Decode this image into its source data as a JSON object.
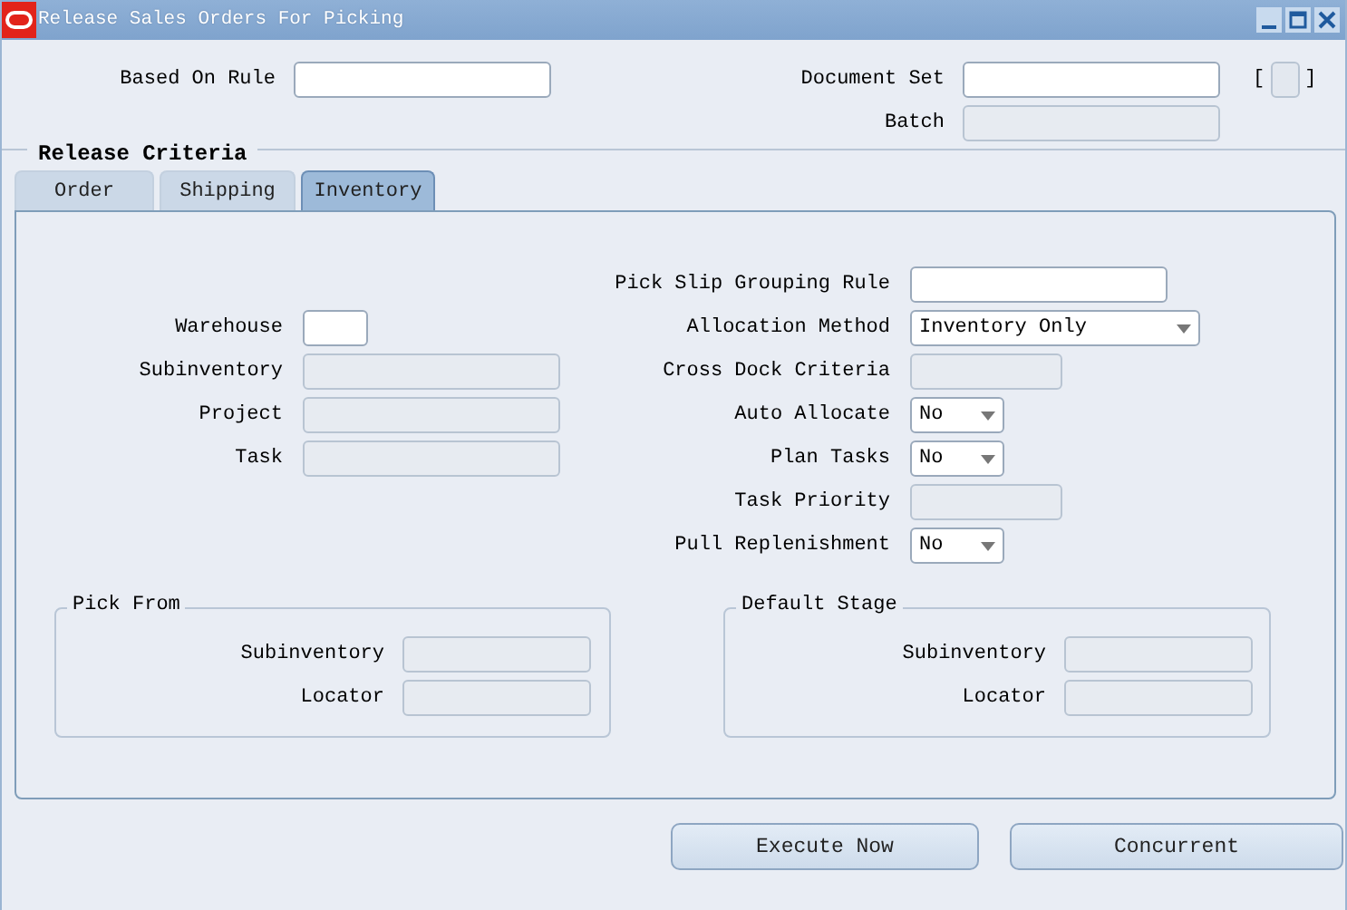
{
  "window": {
    "title": "Release Sales Orders For Picking"
  },
  "header_fields": [
    {
      "label": "Based On Rule",
      "kind": "text"
    },
    {
      "label": "Document Set",
      "kind": "text"
    },
    {
      "label": "Batch",
      "kind": "disabled"
    }
  ],
  "flex_field": {
    "open": "[",
    "close": "]"
  },
  "section_title": "Release Criteria",
  "tabs": [
    {
      "label": "Order",
      "selected": false
    },
    {
      "label": "Shipping",
      "selected": false
    },
    {
      "label": "Inventory",
      "selected": true
    }
  ],
  "left_fields": [
    {
      "label": "Warehouse",
      "kind": "text"
    },
    {
      "label": "Subinventory",
      "kind": "disabled"
    },
    {
      "label": "Project",
      "kind": "disabled"
    },
    {
      "label": "Task",
      "kind": "disabled"
    }
  ],
  "right_fields": [
    {
      "label": "Pick Slip Grouping Rule",
      "kind": "text"
    },
    {
      "label": "Allocation Method",
      "kind": "select",
      "value": "Inventory Only"
    },
    {
      "label": "Cross Dock Criteria",
      "kind": "disabled"
    },
    {
      "label": "Auto Allocate",
      "kind": "select",
      "value": "No"
    },
    {
      "label": "Plan Tasks",
      "kind": "select",
      "value": "No"
    },
    {
      "label": "Task Priority",
      "kind": "disabled"
    },
    {
      "label": "Pull Replenishment",
      "kind": "select",
      "value": "No"
    }
  ],
  "groups": [
    {
      "title": "Pick From",
      "fields": [
        {
          "label": "Subinventory",
          "kind": "disabled"
        },
        {
          "label": "Locator",
          "kind": "disabled"
        }
      ]
    },
    {
      "title": "Default Stage",
      "fields": [
        {
          "label": "Subinventory",
          "kind": "disabled"
        },
        {
          "label": "Locator",
          "kind": "disabled"
        }
      ]
    }
  ],
  "buttons": [
    {
      "label": "Execute Now"
    },
    {
      "label": "Concurrent"
    }
  ]
}
